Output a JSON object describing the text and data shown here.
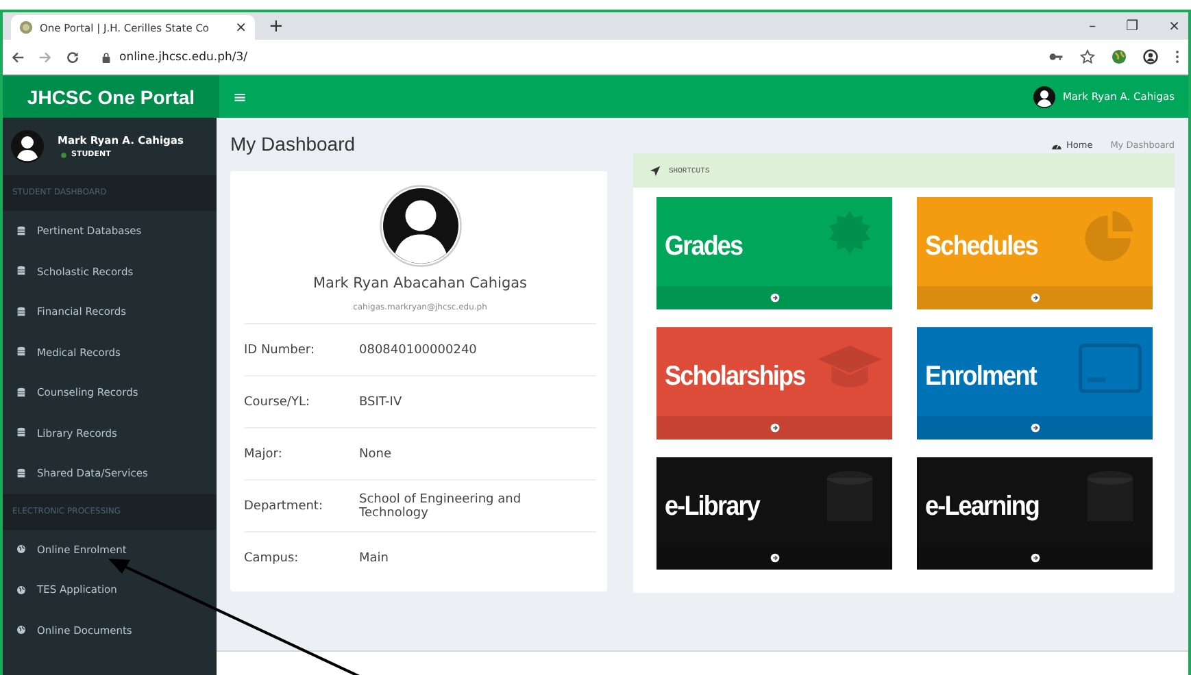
{
  "browser": {
    "tab_title": "One Portal | J.H. Cerilles State Co",
    "tab_close": "×",
    "new_tab": "+",
    "url": "online.jhcsc.edu.ph/3/",
    "window_controls": [
      "–",
      "❐",
      "×"
    ]
  },
  "header": {
    "brand": "JHCSC One Portal",
    "menu": "≡",
    "user": "Mark Ryan A. Cahigas"
  },
  "sidebar": {
    "user": {
      "name": "Mark Ryan A. Cahigas",
      "role": "STUDENT"
    },
    "sections": [
      {
        "title": "STUDENT DASHBOARD",
        "items": [
          "Pertinent Databases",
          "Scholastic Records",
          "Financial Records",
          "Medical Records",
          "Counseling Records",
          "Library Records",
          "Shared Data/Services"
        ]
      },
      {
        "title": "ELECTRONIC PROCESSING",
        "items": [
          "Online Enrolment",
          "TES Application",
          "Online Documents"
        ]
      }
    ]
  },
  "page": {
    "title": "My Dashboard",
    "breadcrumb": [
      "Home",
      "My Dashboard"
    ]
  },
  "profile": {
    "name": "Mark Ryan Abacahan Cahigas",
    "email": "cahigas.markryan@jhcsc.edu.ph",
    "fields": [
      {
        "label": "ID Number:",
        "value": "080840100000240"
      },
      {
        "label": "Course/YL:",
        "value": "BSIT-IV"
      },
      {
        "label": "Major:",
        "value": "None"
      },
      {
        "label": "Department:",
        "value": "School of Engineering and Technology"
      },
      {
        "label": "Campus:",
        "value": "Main"
      }
    ]
  },
  "shortcuts": {
    "title": "SHORTCUTS",
    "tiles": [
      {
        "label": "Grades",
        "color": "#00a65a"
      },
      {
        "label": "Schedules",
        "color": "#f39c12"
      },
      {
        "label": "Scholarships",
        "color": "#dd4b39"
      },
      {
        "label": "Enrolment",
        "color": "#0073b7"
      },
      {
        "label": "e-Library",
        "color": "#111111"
      },
      {
        "label": "e-Learning",
        "color": "#111111"
      }
    ]
  }
}
